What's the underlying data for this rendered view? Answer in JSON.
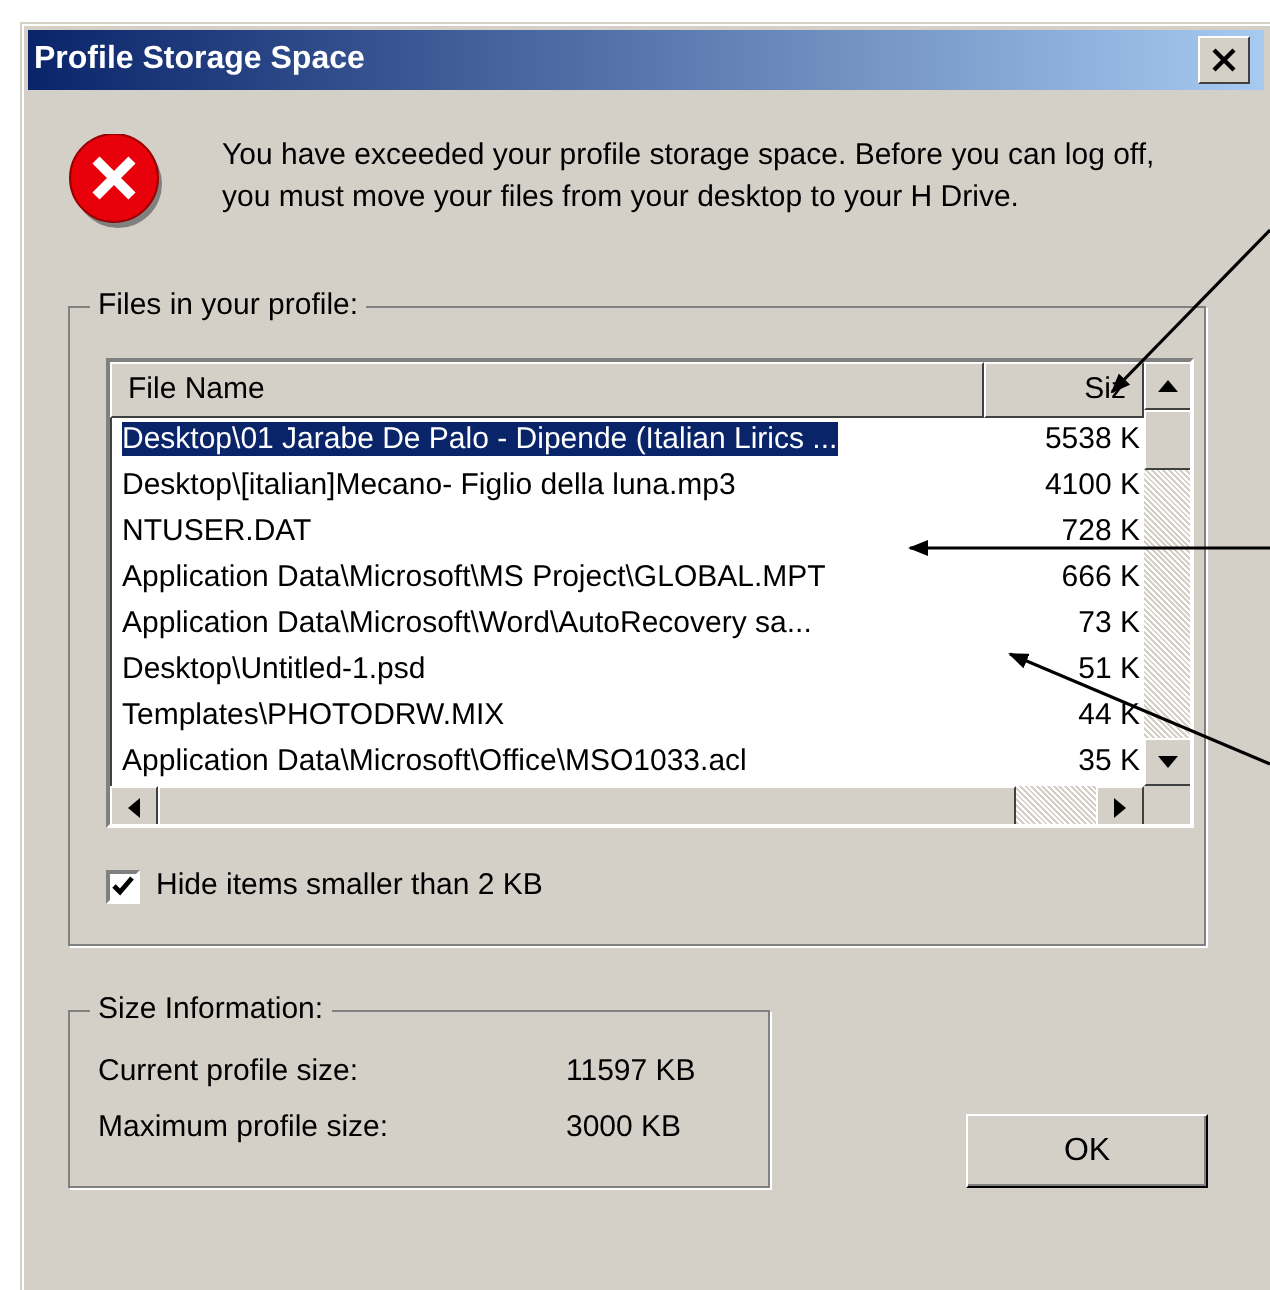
{
  "window": {
    "title": "Profile Storage Space"
  },
  "message": "You have exceeded your profile storage space. Before you can log off, you must move your files from your desktop to your H Drive.",
  "files_group": {
    "title": "Files in your profile:",
    "columns": [
      "File Name",
      "Siz"
    ],
    "rows": [
      {
        "name": "Desktop\\01 Jarabe De Palo - Dipende (Italian Lirics ...",
        "size": "5538 K",
        "selected": true
      },
      {
        "name": "Desktop\\[italian]Mecano- Figlio della luna.mp3",
        "size": "4100 K",
        "selected": false
      },
      {
        "name": "NTUSER.DAT",
        "size": "728 K",
        "selected": false
      },
      {
        "name": "Application Data\\Microsoft\\MS Project\\GLOBAL.MPT",
        "size": "666 K",
        "selected": false
      },
      {
        "name": "Application Data\\Microsoft\\Word\\AutoRecovery sa...",
        "size": "73 K",
        "selected": false
      },
      {
        "name": "Desktop\\Untitled-1.psd",
        "size": "51 K",
        "selected": false
      },
      {
        "name": "Templates\\PHOTODRW.MIX",
        "size": "44 K",
        "selected": false
      },
      {
        "name": "Application Data\\Microsoft\\Office\\MSO1033.acl",
        "size": "35 K",
        "selected": false
      }
    ],
    "hide_small": {
      "label": "Hide items smaller than 2 KB",
      "checked": true
    }
  },
  "size_info": {
    "title": "Size Information:",
    "rows": [
      {
        "label": "Current profile size:",
        "value": "11597 KB"
      },
      {
        "label": "Maximum profile size:",
        "value": "3000 KB"
      }
    ]
  },
  "buttons": [
    "OK"
  ]
}
